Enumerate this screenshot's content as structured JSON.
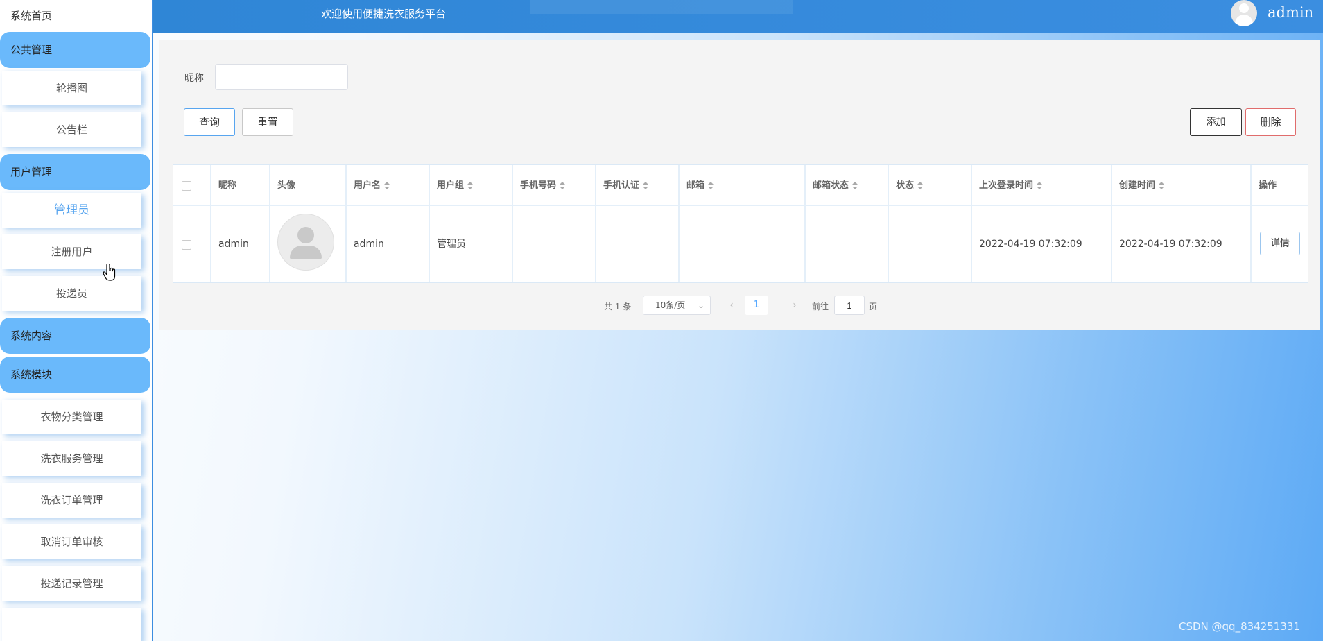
{
  "sidebar": {
    "home": "系统首页",
    "groups": [
      {
        "label": "公共管理",
        "items": [
          "轮播图",
          "公告栏"
        ]
      },
      {
        "label": "用户管理",
        "items": [
          "管理员",
          "注册用户",
          "投递员"
        ]
      },
      {
        "label": "系统内容",
        "items": []
      },
      {
        "label": "系统模块",
        "items": [
          "衣物分类管理",
          "洗衣服务管理",
          "洗衣订单管理",
          "取消订单审核",
          "投递记录管理"
        ]
      }
    ],
    "active_item": "管理员"
  },
  "header": {
    "title": "欢迎使用便捷洗衣服务平台",
    "user": "admin"
  },
  "search": {
    "label": "昵称",
    "value": "",
    "query_button": "查询",
    "reset_button": "重置"
  },
  "actions": {
    "add_button": "添加",
    "delete_button": "删除"
  },
  "table": {
    "columns": [
      "昵称",
      "头像",
      "用户名",
      "用户组",
      "手机号码",
      "手机认证",
      "邮箱",
      "邮箱状态",
      "状态",
      "上次登录时间",
      "创建时间",
      "操作"
    ],
    "rows": [
      {
        "nickname": "admin",
        "username": "admin",
        "group": "管理员",
        "phone": "",
        "phone_verified": "",
        "email": "",
        "email_status": "",
        "status": "",
        "last_login": "2022-04-19 07:32:09",
        "created": "2022-04-19 07:32:09",
        "action": "详情"
      }
    ]
  },
  "pagination": {
    "total": "共 1 条",
    "page_size": "10条/页",
    "current_page": "1",
    "goto_label": "前往",
    "goto_value": "1",
    "goto_unit": "页"
  },
  "watermark": "CSDN @qq_834251331",
  "colors": {
    "header": "#2f86d6",
    "sidebar_group": "#6ab9fb",
    "accent": "#409eff",
    "danger_border": "#e06c6c"
  }
}
